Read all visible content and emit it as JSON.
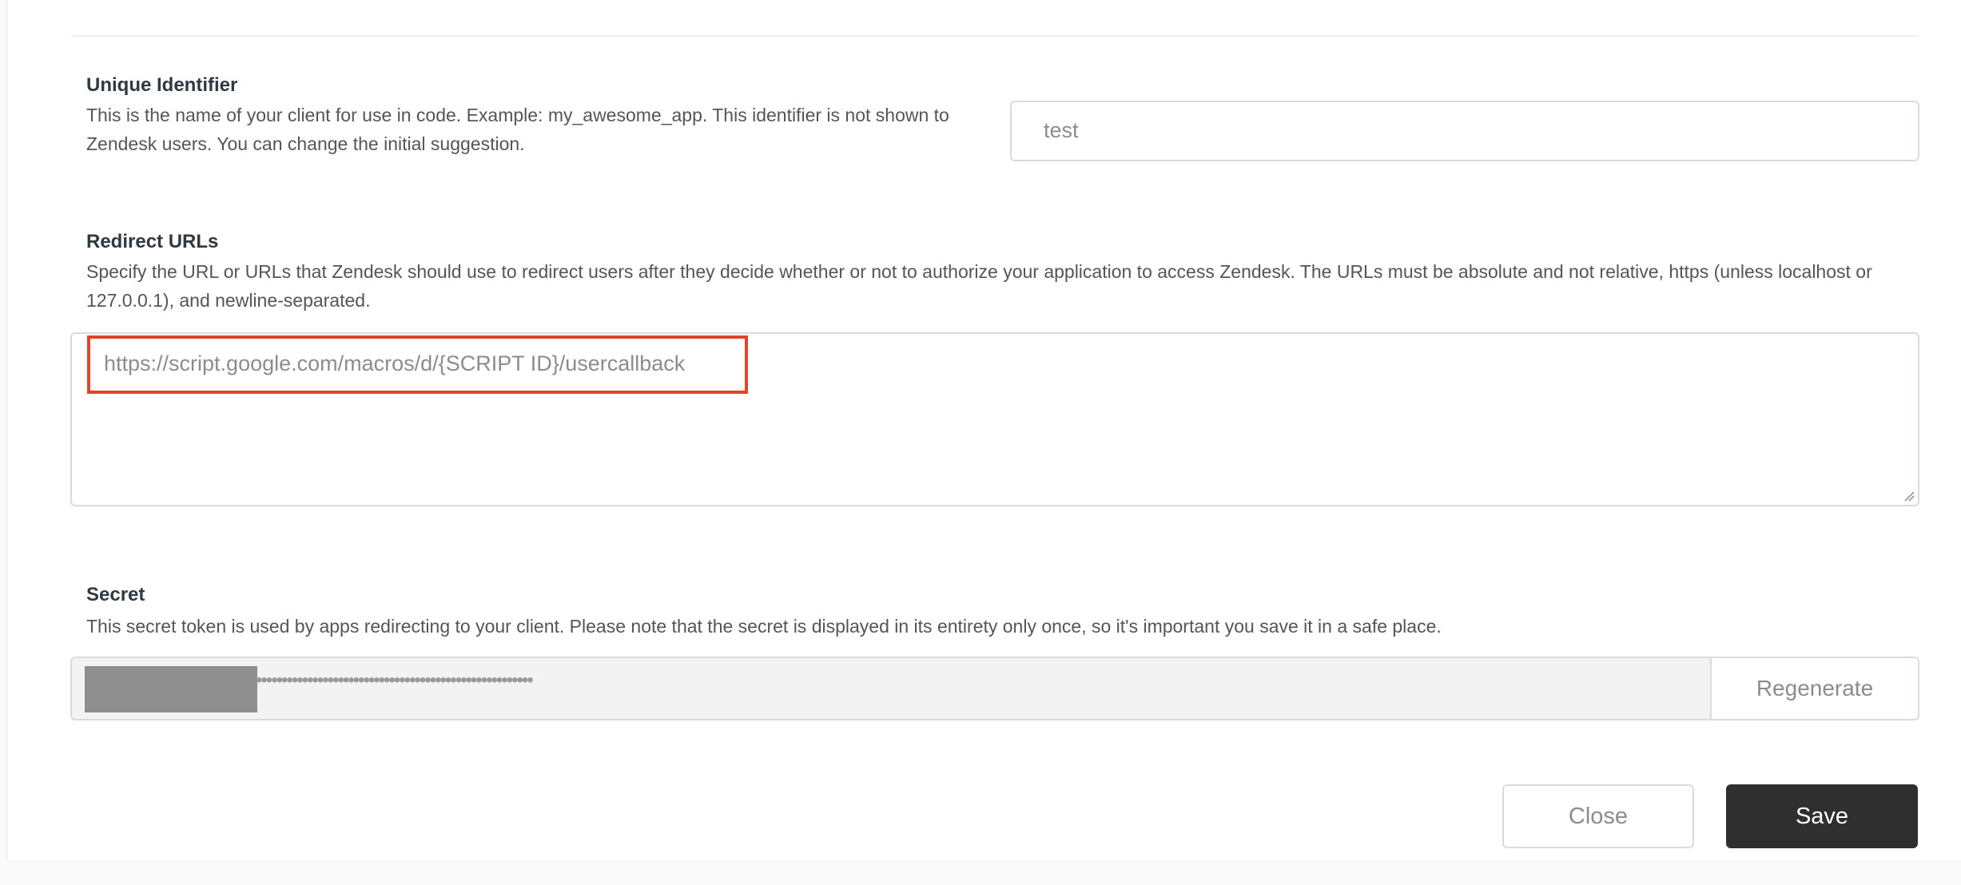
{
  "unique_identifier": {
    "label": "Unique Identifier",
    "description": "This is the name of your client for use in code. Example: my_awesome_app. This identifier is not shown to Zendesk users. You can change the initial suggestion.",
    "value": "test"
  },
  "redirect_urls": {
    "label": "Redirect URLs",
    "description": "Specify the URL or URLs that Zendesk should use to redirect users after they decide whether or not to authorize your application to access Zendesk. The URLs must be absolute and not relative, https (unless localhost or 127.0.0.1), and newline-separated.",
    "value": "https://script.google.com/macros/d/{SCRIPT ID}/usercallback"
  },
  "secret": {
    "label": "Secret",
    "description": "This secret token is used by apps redirecting to your client. Please note that the secret is displayed in its entirety only once, so it's important you save it in a safe place.",
    "masked_value": "••••••••••••••••••••••••••••••••••••••••••••••••••••••",
    "regenerate_label": "Regenerate"
  },
  "actions": {
    "close_label": "Close",
    "save_label": "Save"
  },
  "colors": {
    "highlight": "#e0442b",
    "save_button": "#2f2f2f"
  }
}
